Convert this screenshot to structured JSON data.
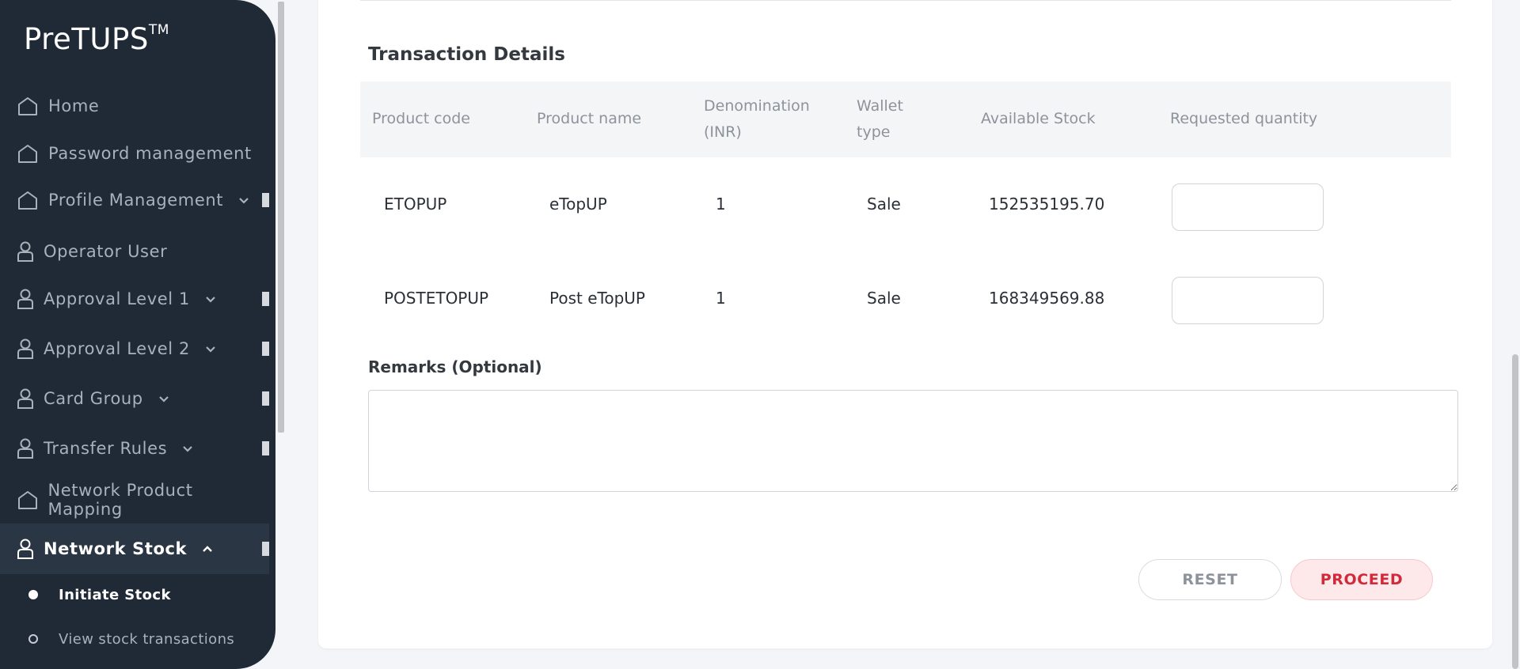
{
  "app": {
    "logo": "PreTUPS",
    "logo_tm": "TM"
  },
  "sidebar": {
    "items": [
      {
        "label": "Home",
        "icon": "home-icon"
      },
      {
        "label": "Password management",
        "icon": "home-icon"
      },
      {
        "label": "Profile Management",
        "icon": "home-icon"
      },
      {
        "label": "Operator User",
        "icon": "user-icon"
      },
      {
        "label": "Approval Level 1",
        "icon": "user-icon"
      },
      {
        "label": "Approval Level 2",
        "icon": "user-icon"
      },
      {
        "label": "Card Group",
        "icon": "user-icon"
      },
      {
        "label": "Transfer Rules",
        "icon": "user-icon"
      },
      {
        "label": "Network Product Mapping",
        "icon": "home-icon"
      },
      {
        "label": "Network Stock",
        "icon": "user-icon"
      }
    ],
    "sub_items": [
      {
        "label": "Initiate Stock"
      },
      {
        "label": "View stock transactions"
      }
    ]
  },
  "main": {
    "section_title": "Transaction Details",
    "table": {
      "headers": [
        "Product code",
        "Product name",
        "Denomination",
        "(INR)",
        "Wallet",
        "type",
        "Available Stock",
        "Requested quantity"
      ],
      "rows": [
        {
          "code": "ETOPUP",
          "name": "eTopUP",
          "denomination": "1",
          "wallet": "Sale",
          "stock": "152535195.70",
          "qty": ""
        },
        {
          "code": "POSTETOPUP",
          "name": "Post eTopUP",
          "denomination": "1",
          "wallet": "Sale",
          "stock": "168349569.88",
          "qty": ""
        }
      ]
    },
    "remarks_label": "Remarks (Optional)",
    "remarks_value": "",
    "buttons": {
      "reset": "RESET",
      "proceed": "PROCEED"
    }
  },
  "colors": {
    "sidebar_bg": "#1f2a36",
    "accent": "#d22a3a",
    "proceed_bg": "#fde8ea"
  }
}
